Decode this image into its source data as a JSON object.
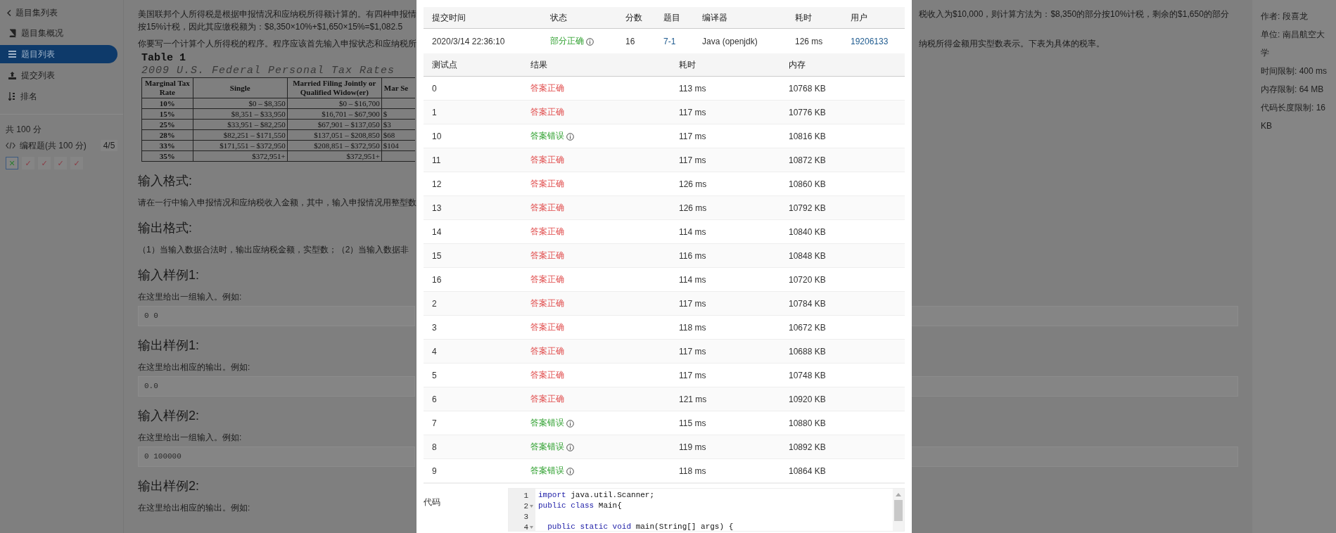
{
  "sidebar": {
    "back_link": "题目集列表",
    "items": [
      {
        "label": "题目集概况",
        "selected": false
      },
      {
        "label": "题目列表",
        "selected": true
      },
      {
        "label": "提交列表",
        "selected": false
      },
      {
        "label": "排名",
        "selected": false
      }
    ],
    "total_score": "共 100 分",
    "section": {
      "label": "编程题(共 100 分)",
      "progress": "4/5"
    },
    "problems": [
      {
        "glyph": "✕",
        "color": "#2e7d32",
        "selected": true
      },
      {
        "glyph": "✓",
        "color": "#8c3a44",
        "selected": false
      },
      {
        "glyph": "✓",
        "color": "#8c3a44",
        "selected": false
      },
      {
        "glyph": "✓",
        "color": "#8c3a44",
        "selected": false
      },
      {
        "glyph": "✓",
        "color": "#8c3a44",
        "selected": false
      }
    ]
  },
  "problem": {
    "intro": [
      {
        "left_part": "美国联邦个人所得税是根据申报情况和应纳税所得额计算的。有四种申报情",
        "right_part": "税收入为$10,000，则计算方法为：$8,350的部分按10%计税，剩余的$1,650的部分"
      },
      {
        "left_part": "按15%计税，因此其应缴税额为：$8,350×10%+$1,650×15%=$1,082.5"
      },
      {
        "left_part": "你要写一个计算个人所得税的程序。程序应该首先输入申报状态和应纳税所",
        "right_part": "纳税所得金额用实型数表示。下表为具体的税率。"
      }
    ],
    "table_title": "Table 1",
    "table_subtitle": "2009 U.S. Federal Personal Tax Rates",
    "table_header": [
      "Marginal Tax Rate",
      "Single",
      "Married Filing Jointly or Qualified Widow(er)",
      "Mar Se"
    ],
    "table_rows": [
      {
        "rate": "10%",
        "single": "$0 – $8,350",
        "joint": "$0 – $16,700"
      },
      {
        "rate": "15%",
        "single": "$8,351 – $33,950",
        "joint": "$16,701 – $67,900",
        "column_4": "$"
      },
      {
        "rate": "25%",
        "single": "$33,951 – $82,250",
        "joint": "$67,901 – $137,050",
        "column_4": "$3"
      },
      {
        "rate": "28%",
        "single": "$82,251 – $171,550",
        "joint": "$137,051 – $208,850",
        "column_4": "$68"
      },
      {
        "rate": "33%",
        "single": "$171,551 – $372,950",
        "joint": "$208,851 – $372,950",
        "column_4": "$104"
      },
      {
        "rate": "35%",
        "single": "$372,951+",
        "joint": "$372,951+"
      }
    ],
    "sections": [
      {
        "heading": "输入格式:",
        "text": "请在一行中输入申报情况和应纳税收入金额，其中，输入申报情况用整型数"
      },
      {
        "heading": "输出格式:",
        "text": "（1）当输入数据合法时，输出应纳税金额，实型数；（2）当输入数据非"
      },
      {
        "heading": "输入样例1:",
        "text": "在这里给出一组输入。例如:",
        "code": "0 0"
      },
      {
        "heading": "输出样例1:",
        "text": "在这里给出相应的输出。例如:",
        "code": "0.0"
      },
      {
        "heading": "输入样例2:",
        "text": "在这里给出一组输入。例如:",
        "code": "0 100000"
      },
      {
        "heading": "输出样例2:",
        "text": "在这里给出相应的输出。例如:"
      }
    ]
  },
  "info": [
    "作者: 段喜龙",
    "单位: 南昌航空大学",
    "时间限制: 400 ms",
    "内存限制: 64 MB",
    "代码长度限制: 16 KB"
  ],
  "dialog": {
    "submission_columns": [
      "提交时间",
      "状态",
      "分数",
      "题目",
      "编译器",
      "耗时",
      "用户"
    ],
    "submission": {
      "time": "2020/3/14 22:36:10",
      "status": "部分正确",
      "score": "16",
      "problem": "7-1",
      "compiler": "Java (openjdk)",
      "duration": "126 ms",
      "user": "19206133"
    },
    "test_columns": [
      "测试点",
      "结果",
      "耗时",
      "内存"
    ],
    "tests": [
      {
        "case": "0",
        "result": "答案正确",
        "kind": "pass",
        "time": "113 ms",
        "memory": "10768 KB"
      },
      {
        "case": "1",
        "result": "答案正确",
        "kind": "pass",
        "time": "117 ms",
        "memory": "10776 KB"
      },
      {
        "case": "10",
        "result": "答案错误",
        "kind": "fail",
        "time": "117 ms",
        "memory": "10816 KB"
      },
      {
        "case": "11",
        "result": "答案正确",
        "kind": "pass",
        "time": "117 ms",
        "memory": "10872 KB"
      },
      {
        "case": "12",
        "result": "答案正确",
        "kind": "pass",
        "time": "126 ms",
        "memory": "10860 KB"
      },
      {
        "case": "13",
        "result": "答案正确",
        "kind": "pass",
        "time": "126 ms",
        "memory": "10792 KB"
      },
      {
        "case": "14",
        "result": "答案正确",
        "kind": "pass",
        "time": "114 ms",
        "memory": "10840 KB"
      },
      {
        "case": "15",
        "result": "答案正确",
        "kind": "pass",
        "time": "116 ms",
        "memory": "10848 KB"
      },
      {
        "case": "16",
        "result": "答案正确",
        "kind": "pass",
        "time": "114 ms",
        "memory": "10720 KB"
      },
      {
        "case": "2",
        "result": "答案正确",
        "kind": "pass",
        "time": "117 ms",
        "memory": "10784 KB"
      },
      {
        "case": "3",
        "result": "答案正确",
        "kind": "pass",
        "time": "118 ms",
        "memory": "10672 KB"
      },
      {
        "case": "4",
        "result": "答案正确",
        "kind": "pass",
        "time": "117 ms",
        "memory": "10688 KB"
      },
      {
        "case": "5",
        "result": "答案正确",
        "kind": "pass",
        "time": "117 ms",
        "memory": "10748 KB"
      },
      {
        "case": "6",
        "result": "答案正确",
        "kind": "pass",
        "time": "121 ms",
        "memory": "10920 KB"
      },
      {
        "case": "7",
        "result": "答案错误",
        "kind": "fail",
        "time": "115 ms",
        "memory": "10880 KB"
      },
      {
        "case": "8",
        "result": "答案错误",
        "kind": "fail",
        "time": "119 ms",
        "memory": "10892 KB"
      },
      {
        "case": "9",
        "result": "答案错误",
        "kind": "fail",
        "time": "118 ms",
        "memory": "10864 KB"
      }
    ],
    "code_label": "代码",
    "code_lines": [
      {
        "number": "1",
        "foldable": false,
        "tokens": [
          {
            "kind": "keyword",
            "text": "import"
          },
          {
            "kind": "plain",
            "text": " java.util.Scanner;"
          }
        ]
      },
      {
        "number": "2",
        "foldable": true,
        "tokens": [
          {
            "kind": "keyword",
            "text": "public class"
          },
          {
            "kind": "plain",
            "text": " Main{"
          }
        ]
      },
      {
        "number": "3",
        "foldable": false
      },
      {
        "number": "4",
        "foldable": true,
        "tokens": [
          {
            "kind": "keyword",
            "text": "  public static void"
          },
          {
            "kind": "plain",
            "text": " main(String[] args) {"
          }
        ]
      }
    ]
  }
}
